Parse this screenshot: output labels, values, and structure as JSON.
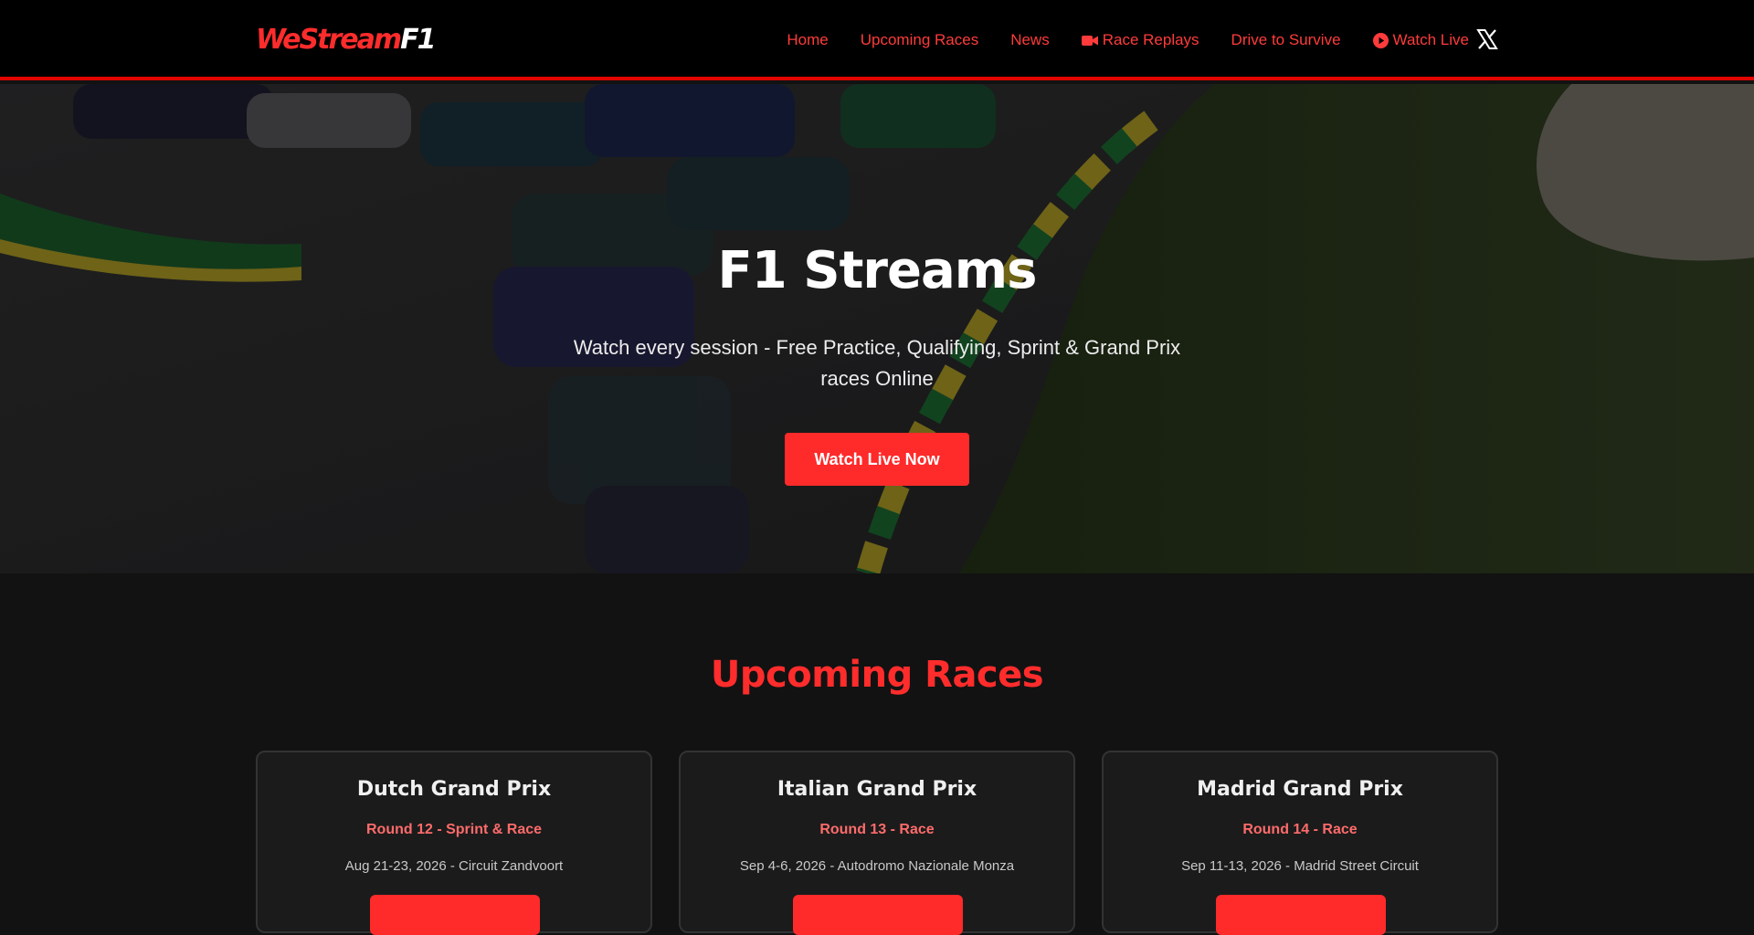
{
  "header": {
    "logo_part1": "WeStream",
    "logo_part2": "F1",
    "nav": [
      {
        "label": "Home"
      },
      {
        "label": "Upcoming Races"
      },
      {
        "label": "News"
      },
      {
        "label": "Race Replays",
        "icon": "video-camera-icon"
      },
      {
        "label": "Drive to Survive"
      },
      {
        "label": "Watch Live",
        "icon": "play-circle-icon"
      }
    ],
    "social_icon": "x-icon"
  },
  "hero": {
    "title": "F1 Streams",
    "subtitle": "Watch every session - Free Practice, Qualifying, Sprint & Grand Prix races Online",
    "button": "Watch Live Now"
  },
  "upcoming": {
    "title": "Upcoming Races",
    "races": [
      {
        "name": "Dutch Grand Prix",
        "round": "Round 12 - Sprint & Race",
        "date": "Aug 21-23, 2026 - Circuit Zandvoort"
      },
      {
        "name": "Italian Grand Prix",
        "round": "Round 13 - Race",
        "date": "Sep 4-6, 2026 - Autodromo Nazionale Monza"
      },
      {
        "name": "Madrid Grand Prix",
        "round": "Round 14 - Race",
        "date": "Sep 11-13, 2026 - Madrid Street Circuit"
      }
    ]
  },
  "colors": {
    "accent": "#ff2c2c",
    "header_bg": "#000000",
    "page_bg": "#121212",
    "card_bg": "#1b1b1b"
  }
}
